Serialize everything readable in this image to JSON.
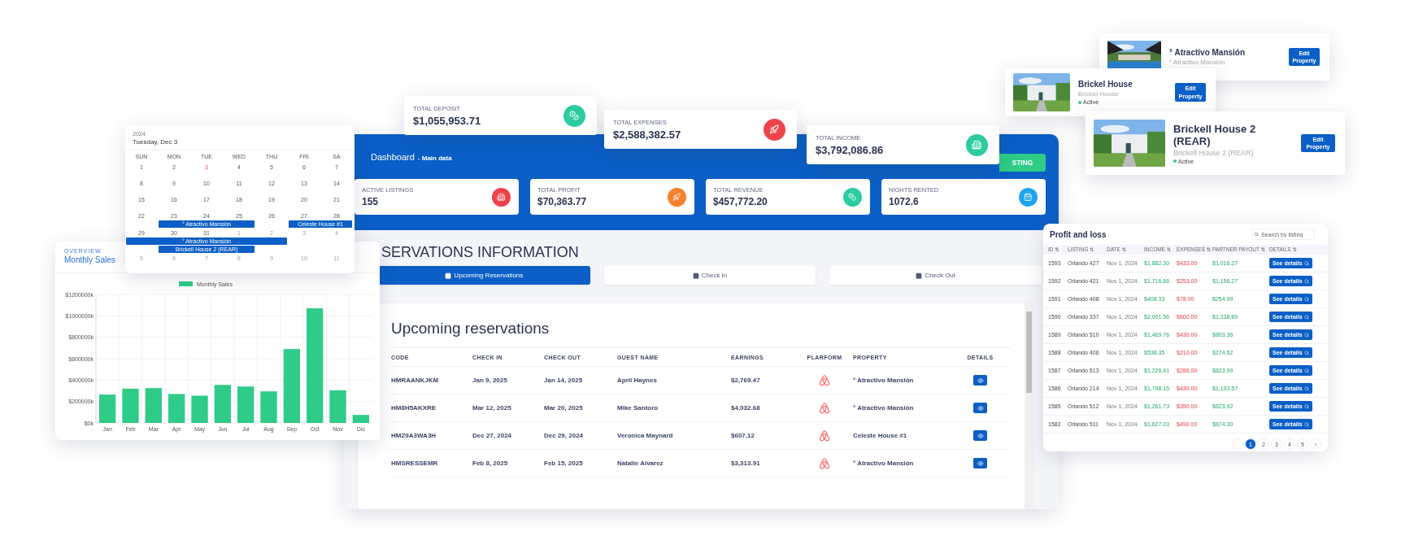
{
  "dashboard": {
    "title": "Dashboard",
    "subtitle": "- Main data",
    "action_button": "STING",
    "stats": [
      {
        "label": "ACTIVE LISTINGS",
        "value": "155",
        "kind": "building",
        "color": "#f0434a"
      },
      {
        "label": "TOTAL PROFIT",
        "value": "$70,363.77",
        "kind": "rocket",
        "color": "#f7812b"
      },
      {
        "label": "TOTAL REVENUE",
        "value": "$457,772.20",
        "kind": "coins",
        "color": "#2dcca0"
      },
      {
        "label": "NIGHTS RENTED",
        "value": "1072.6",
        "kind": "calendar",
        "color": "#1ea4ef"
      }
    ],
    "section_title": "SERVATIONS INFORMATION",
    "tabs": [
      {
        "label": "Upcoming Reservations",
        "selected": true
      },
      {
        "label": "Check In",
        "selected": false
      },
      {
        "label": "Check Out",
        "selected": false
      }
    ],
    "reservations": {
      "title": "Upcoming reservations",
      "columns": [
        "CODE",
        "CHECK IN",
        "CHECK OUT",
        "GUEST NAME",
        "EARNINGS",
        "PLARFORM",
        "PROPERTY",
        "DETAILS"
      ],
      "rows": [
        {
          "code": "HMRAANKJKM",
          "check_in": "Jan 9, 2025",
          "check_out": "Jan 14, 2025",
          "guest": "April Haynes",
          "earnings": "$2,769.47",
          "property": "° Atractivo Mansión"
        },
        {
          "code": "HM8H5AKXRE",
          "check_in": "Mar 12, 2025",
          "check_out": "Mar 20, 2025",
          "guest": "Mike Santoro",
          "earnings": "$4,032.68",
          "property": "° Atractivo Mansión"
        },
        {
          "code": "HMZ9A3WA3H",
          "check_in": "Dec 27, 2024",
          "check_out": "Dec 29, 2024",
          "guest": "Veronica Maynard",
          "earnings": "$607.12",
          "property": "Celeste House #1"
        },
        {
          "code": "HMSRESSEMR",
          "check_in": "Feb 8, 2025",
          "check_out": "Feb 15, 2025",
          "guest": "Natalie Alvarez",
          "earnings": "$3,313.91",
          "property": "° Atractivo Mansión"
        }
      ]
    }
  },
  "summary_cards": [
    {
      "label": "TOTAL DEPOSIT",
      "value": "$1,055,953.71",
      "kind": "coins",
      "color": "#2dcca0"
    },
    {
      "label": "TOTAL EXPENSES",
      "value": "$2,588,382.57",
      "kind": "rocket",
      "color": "#f0434a"
    },
    {
      "label": "TOTAL INCOME",
      "value": "$3,792,086.86",
      "kind": "building",
      "color": "#2dcca0"
    }
  ],
  "calendar": {
    "year": "2024",
    "date": "Tuesday, Dec 3",
    "weekdays": [
      "SUN",
      "MON",
      "TUE",
      "WED",
      "THU",
      "FRI",
      "SA"
    ],
    "weeks": [
      {
        "days": [
          {
            "label": "1",
            "muted": false,
            "today": false
          },
          {
            "label": "2",
            "muted": false,
            "today": false
          },
          {
            "label": "3",
            "muted": false,
            "today": true
          },
          {
            "label": "4",
            "muted": false,
            "today": false
          },
          {
            "label": "5",
            "muted": false,
            "today": false
          },
          {
            "label": "6",
            "muted": false,
            "today": false
          },
          {
            "label": "7",
            "muted": false,
            "today": false
          }
        ]
      },
      {
        "days": [
          {
            "label": "8",
            "muted": false,
            "today": false
          },
          {
            "label": "9",
            "muted": false,
            "today": false
          },
          {
            "label": "10",
            "muted": false,
            "today": false
          },
          {
            "label": "11",
            "muted": false,
            "today": false
          },
          {
            "label": "12",
            "muted": false,
            "today": false
          },
          {
            "label": "13",
            "muted": false,
            "today": false
          },
          {
            "label": "14",
            "muted": false,
            "today": false
          }
        ]
      },
      {
        "days": [
          {
            "label": "15",
            "muted": false,
            "today": false
          },
          {
            "label": "16",
            "muted": false,
            "today": false
          },
          {
            "label": "17",
            "muted": false,
            "today": false
          },
          {
            "label": "18",
            "muted": false,
            "today": false
          },
          {
            "label": "19",
            "muted": false,
            "today": false
          },
          {
            "label": "20",
            "muted": false,
            "today": false
          },
          {
            "label": "21",
            "muted": false,
            "today": false
          }
        ]
      },
      {
        "days": [
          {
            "label": "22",
            "muted": false,
            "today": false
          },
          {
            "label": "23",
            "muted": false,
            "today": false
          },
          {
            "label": "24",
            "muted": false,
            "today": false
          },
          {
            "label": "25",
            "muted": false,
            "today": false
          },
          {
            "label": "26",
            "muted": false,
            "today": false
          },
          {
            "label": "27",
            "muted": false,
            "today": false
          },
          {
            "label": "28",
            "muted": false,
            "today": false
          }
        ],
        "lanes": [
          [
            {
              "kind": "empty"
            },
            {
              "kind": "start",
              "label": "° Atractivo Mansión"
            },
            {
              "kind": "continue"
            },
            {
              "kind": "continue"
            },
            {
              "kind": "empty"
            },
            {
              "kind": "start",
              "label": "Celeste House #1"
            },
            {
              "kind": "continue"
            }
          ]
        ]
      },
      {
        "days": [
          {
            "label": "29",
            "muted": false,
            "today": false
          },
          {
            "label": "30",
            "muted": false,
            "today": false
          },
          {
            "label": "31",
            "muted": false,
            "today": false
          },
          {
            "label": "1",
            "muted": true,
            "today": false
          },
          {
            "label": "2",
            "muted": true,
            "today": false
          },
          {
            "label": "3",
            "muted": true,
            "today": false
          },
          {
            "label": "4",
            "muted": true,
            "today": false
          }
        ],
        "lanes": [
          [
            {
              "kind": "start",
              "label": "° Atractivo Mansión"
            },
            {
              "kind": "continue"
            },
            {
              "kind": "continue"
            },
            {
              "kind": "continue"
            },
            {
              "kind": "continue"
            },
            {
              "kind": "empty"
            },
            {
              "kind": "empty"
            }
          ],
          [
            {
              "kind": "empty"
            },
            {
              "kind": "start",
              "label": "Brickell House 2 (REAR)"
            },
            {
              "kind": "continue"
            },
            {
              "kind": "continue"
            },
            {
              "kind": "empty"
            },
            {
              "kind": "empty"
            },
            {
              "kind": "empty"
            }
          ]
        ]
      },
      {
        "days": [
          {
            "label": "5",
            "muted": true,
            "today": false
          },
          {
            "label": "6",
            "muted": true,
            "today": false
          },
          {
            "label": "7",
            "muted": true,
            "today": false
          },
          {
            "label": "8",
            "muted": true,
            "today": false
          },
          {
            "label": "9",
            "muted": true,
            "today": false
          },
          {
            "label": "10",
            "muted": true,
            "today": false
          },
          {
            "label": "11",
            "muted": true,
            "today": false
          }
        ]
      }
    ]
  },
  "sales_card": {
    "overline": "OVERVIEW",
    "title": "Monthly Sales",
    "chart_data": {
      "type": "bar",
      "categories": [
        "Jan",
        "Feb",
        "Mar",
        "Apr",
        "May",
        "Jun",
        "Jul",
        "Aug",
        "Sep",
        "Oct",
        "Nov",
        "Dic"
      ],
      "series": [
        {
          "name": "Monthly Sales",
          "color": "#2ecc87",
          "values": [
            265000,
            320000,
            325000,
            270000,
            255000,
            355000,
            340000,
            295000,
            690000,
            1070000,
            305000,
            75000
          ]
        }
      ],
      "ylim": [
        0,
        1200000
      ],
      "grid": true,
      "yticks": [
        {
          "value": 0,
          "label": "$0k"
        },
        {
          "value": 200000,
          "label": "$200000k"
        },
        {
          "value": 400000,
          "label": "$400000k"
        },
        {
          "value": 600000,
          "label": "$600000k"
        },
        {
          "value": 800000,
          "label": "$800000k"
        },
        {
          "value": 1000000,
          "label": "$1000000k"
        },
        {
          "value": 1200000,
          "label": "$1200000k"
        }
      ]
    }
  },
  "profit_loss": {
    "title": "Profit and loss",
    "search": {
      "placeholder": "Search by listing"
    },
    "columns": [
      "ID ⇅",
      "LISTING ⇅",
      "DATE ⇅",
      "INCOME ⇅",
      "EXPENSES ⇅",
      "PARTNER PAYOUT ⇅",
      "DETAILS ⇅"
    ],
    "rows": [
      {
        "id": "1593",
        "listing": "Orlando 427",
        "date": "Nov 1, 2024",
        "income": "$1,882.30",
        "expenses": "$433.00",
        "payout": "$1,016.27",
        "button": "See details"
      },
      {
        "id": "1592",
        "listing": "Orlando 421",
        "date": "Nov 1, 2024",
        "income": "$1,716.66",
        "expenses": "$253.00",
        "payout": "$1,156.27",
        "button": "See details"
      },
      {
        "id": "1591",
        "listing": "Orlando 408",
        "date": "Nov 1, 2024",
        "income": "$408.33",
        "expenses": "$78.00",
        "payout": "$254.99",
        "button": "See details"
      },
      {
        "id": "1590",
        "listing": "Orlando 337",
        "date": "Nov 1, 2024",
        "income": "$2,001.56",
        "expenses": "$600.00",
        "payout": "$1,238.89",
        "button": "See details"
      },
      {
        "id": "1589",
        "listing": "Orlando 510",
        "date": "Nov 1, 2024",
        "income": "$1,469.76",
        "expenses": "$430.00",
        "payout": "$803.36",
        "button": "See details"
      },
      {
        "id": "1588",
        "listing": "Orlando 406",
        "date": "Nov 1, 2024",
        "income": "$538.35",
        "expenses": "$210.00",
        "payout": "$274.52",
        "button": "See details"
      },
      {
        "id": "1587",
        "listing": "Orlando 513",
        "date": "Nov 1, 2024",
        "income": "$1,226.41",
        "expenses": "$286.00",
        "payout": "$823.99",
        "button": "See details"
      },
      {
        "id": "1586",
        "listing": "Orlando 214",
        "date": "Nov 1, 2024",
        "income": "$1,798.15",
        "expenses": "$430.00",
        "payout": "$1,193.57",
        "button": "See details"
      },
      {
        "id": "1585",
        "listing": "Orlando 512",
        "date": "Nov 1, 2024",
        "income": "$1,261.73",
        "expenses": "$350.00",
        "payout": "$823.92",
        "button": "See details"
      },
      {
        "id": "1582",
        "listing": "Orlando 511",
        "date": "Nov 1, 2024",
        "income": "$1,627.03",
        "expenses": "$490.00",
        "payout": "$874.30",
        "button": "See details"
      }
    ],
    "pages": [
      {
        "label": "1",
        "selected": true
      },
      {
        "label": "2",
        "selected": false
      },
      {
        "label": "3",
        "selected": false
      },
      {
        "label": "4",
        "selected": false
      },
      {
        "label": "5",
        "selected": false
      }
    ],
    "next": "›"
  },
  "properties": [
    {
      "name": "° Atractivo Mansión",
      "subtitle": "° Atractivo Mansión",
      "button": "Edit Property",
      "kind": "pool"
    },
    {
      "name": "Brickel House",
      "subtitle": "Brickel House",
      "status": "Active",
      "button": "Edit Property",
      "kind": "house"
    },
    {
      "name": "Brickell House 2 (REAR)",
      "subtitle": "Brickell House 2 (REAR)",
      "status": "Active",
      "button": "Edit Property",
      "kind": "house"
    }
  ]
}
